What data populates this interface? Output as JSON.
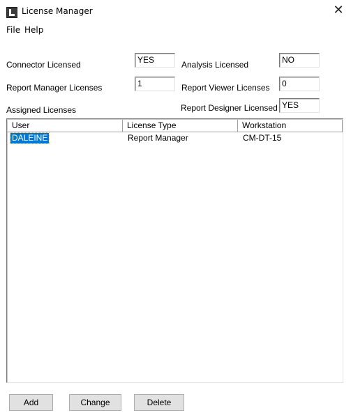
{
  "window": {
    "title": "License Manager",
    "close_glyph": "✕",
    "app_icon": "license-manager-icon"
  },
  "menu": {
    "file": "File",
    "help": "Help"
  },
  "fields": {
    "connector_licensed": {
      "label": "Connector Licensed",
      "value": "YES"
    },
    "analysis_licensed": {
      "label": "Analysis Licensed",
      "value": "NO"
    },
    "report_manager_licenses": {
      "label": "Report Manager Licenses",
      "value": "1"
    },
    "report_viewer_licenses": {
      "label": "Report Viewer Licenses",
      "value": "0"
    },
    "report_designer_licensed": {
      "label": "Report Designer Licensed",
      "value": "YES"
    }
  },
  "assigned": {
    "label": "Assigned Licenses",
    "columns": [
      "User",
      "License Type",
      "Workstation"
    ],
    "rows": [
      {
        "user": "DALEINE",
        "license_type": "Report Manager",
        "workstation": "CM-DT-15",
        "selected": true
      }
    ]
  },
  "buttons": {
    "add": "Add",
    "change": "Change",
    "delete": "Delete"
  }
}
